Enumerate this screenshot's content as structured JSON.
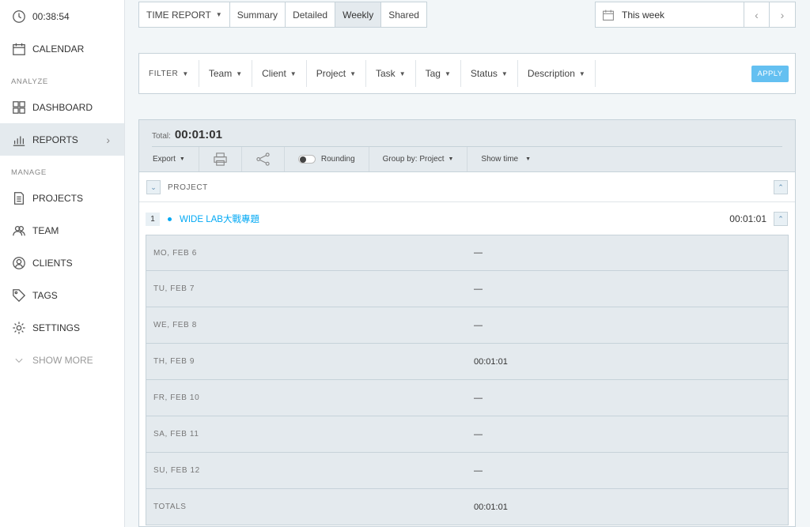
{
  "sidebar": {
    "timer": "00:38:54",
    "calendar": "CALENDAR",
    "analyze_label": "ANALYZE",
    "dashboard": "DASHBOARD",
    "reports": "REPORTS",
    "manage_label": "MANAGE",
    "projects": "PROJECTS",
    "team": "TEAM",
    "clients": "CLIENTS",
    "tags": "TAGS",
    "settings": "SETTINGS",
    "show_more": "SHOW MORE"
  },
  "toolbar": {
    "report_type": "TIME REPORT",
    "tabs": [
      "Summary",
      "Detailed",
      "Weekly",
      "Shared"
    ],
    "active_tab": "Weekly",
    "date_range": "This week"
  },
  "filters": {
    "filter_label": "FILTER",
    "items": [
      "Team",
      "Client",
      "Project",
      "Task",
      "Tag",
      "Status",
      "Description"
    ],
    "apply": "APPLY"
  },
  "report": {
    "total_label": "Total:",
    "total_value": "00:01:01",
    "export": "Export",
    "rounding": "Rounding",
    "group_by": "Group by: Project",
    "show_time": "Show time",
    "column_header": "PROJECT",
    "group": {
      "index": "1",
      "name": "WIDE LAB大戰專題",
      "total": "00:01:01"
    },
    "days": [
      {
        "label": "MO, FEB 6",
        "value": "—"
      },
      {
        "label": "TU, FEB 7",
        "value": "—"
      },
      {
        "label": "WE, FEB 8",
        "value": "—"
      },
      {
        "label": "TH, FEB 9",
        "value": "00:01:01"
      },
      {
        "label": "FR, FEB 10",
        "value": "—"
      },
      {
        "label": "SA, FEB 11",
        "value": "—"
      },
      {
        "label": "SU, FEB 12",
        "value": "—"
      },
      {
        "label": "TOTALS",
        "value": "00:01:01"
      }
    ]
  },
  "colors": {
    "accent": "#03a9f4",
    "apply_button": "#64c0f1",
    "panel_header": "#e4eaee"
  }
}
